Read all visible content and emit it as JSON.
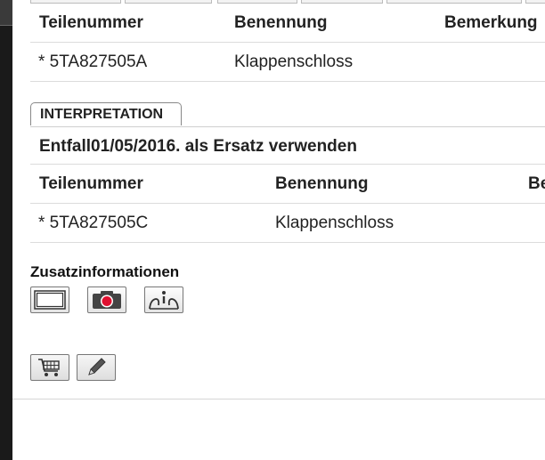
{
  "table1": {
    "headers": {
      "part_no": "Teilenummer",
      "name": "Benennung",
      "remark": "Bemerkung"
    },
    "rows": [
      {
        "part_no": "* 5TA827505A",
        "name": "Klappenschloss"
      }
    ]
  },
  "interpretation": {
    "tab_label": "INTERPRETATION",
    "note": "Entfall01/05/2016. als Ersatz verwenden",
    "headers": {
      "part_no": "Teilenummer",
      "name": "Benennung",
      "remark_partial": "Be"
    },
    "rows": [
      {
        "part_no": "* 5TA827505C",
        "name": "Klappenschloss"
      }
    ]
  },
  "extra": {
    "title": "Zusatzinformationen",
    "icons": [
      "frame-icon",
      "camera-icon",
      "person-info-icon"
    ]
  },
  "actions": {
    "icons": [
      "cart-icon",
      "pencil-icon"
    ]
  },
  "colors": {
    "camera_red": "#e01030",
    "left_bar": "#1a1a1a"
  }
}
